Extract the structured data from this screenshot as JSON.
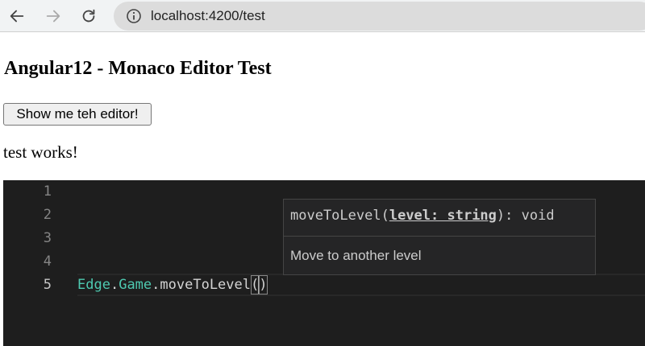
{
  "browser": {
    "url": "localhost:4200/test",
    "icons": {
      "back": "back-arrow-icon",
      "forward": "forward-arrow-icon",
      "reload": "reload-icon",
      "info": "info-icon"
    }
  },
  "page": {
    "title": "Angular12 - Monaco Editor Test",
    "button_label": "Show me teh editor!",
    "status_text": "test works!"
  },
  "editor": {
    "line_numbers": [
      "1",
      "2",
      "3",
      "4",
      "5"
    ],
    "active_line": "5",
    "code": {
      "namespace": "Edge",
      "dot1": ".",
      "class": "Game",
      "dot2": ".",
      "method": "moveToLevel",
      "open_paren": "(",
      "close_paren": ")"
    },
    "colors": {
      "background": "#1e1e1e",
      "type": "#4ec9b0",
      "text": "#d4d4d4"
    }
  },
  "parameter_hint": {
    "name": "moveToLevel",
    "open": "(",
    "param": "level: string",
    "close": "): void",
    "documentation": "Move to another level"
  }
}
